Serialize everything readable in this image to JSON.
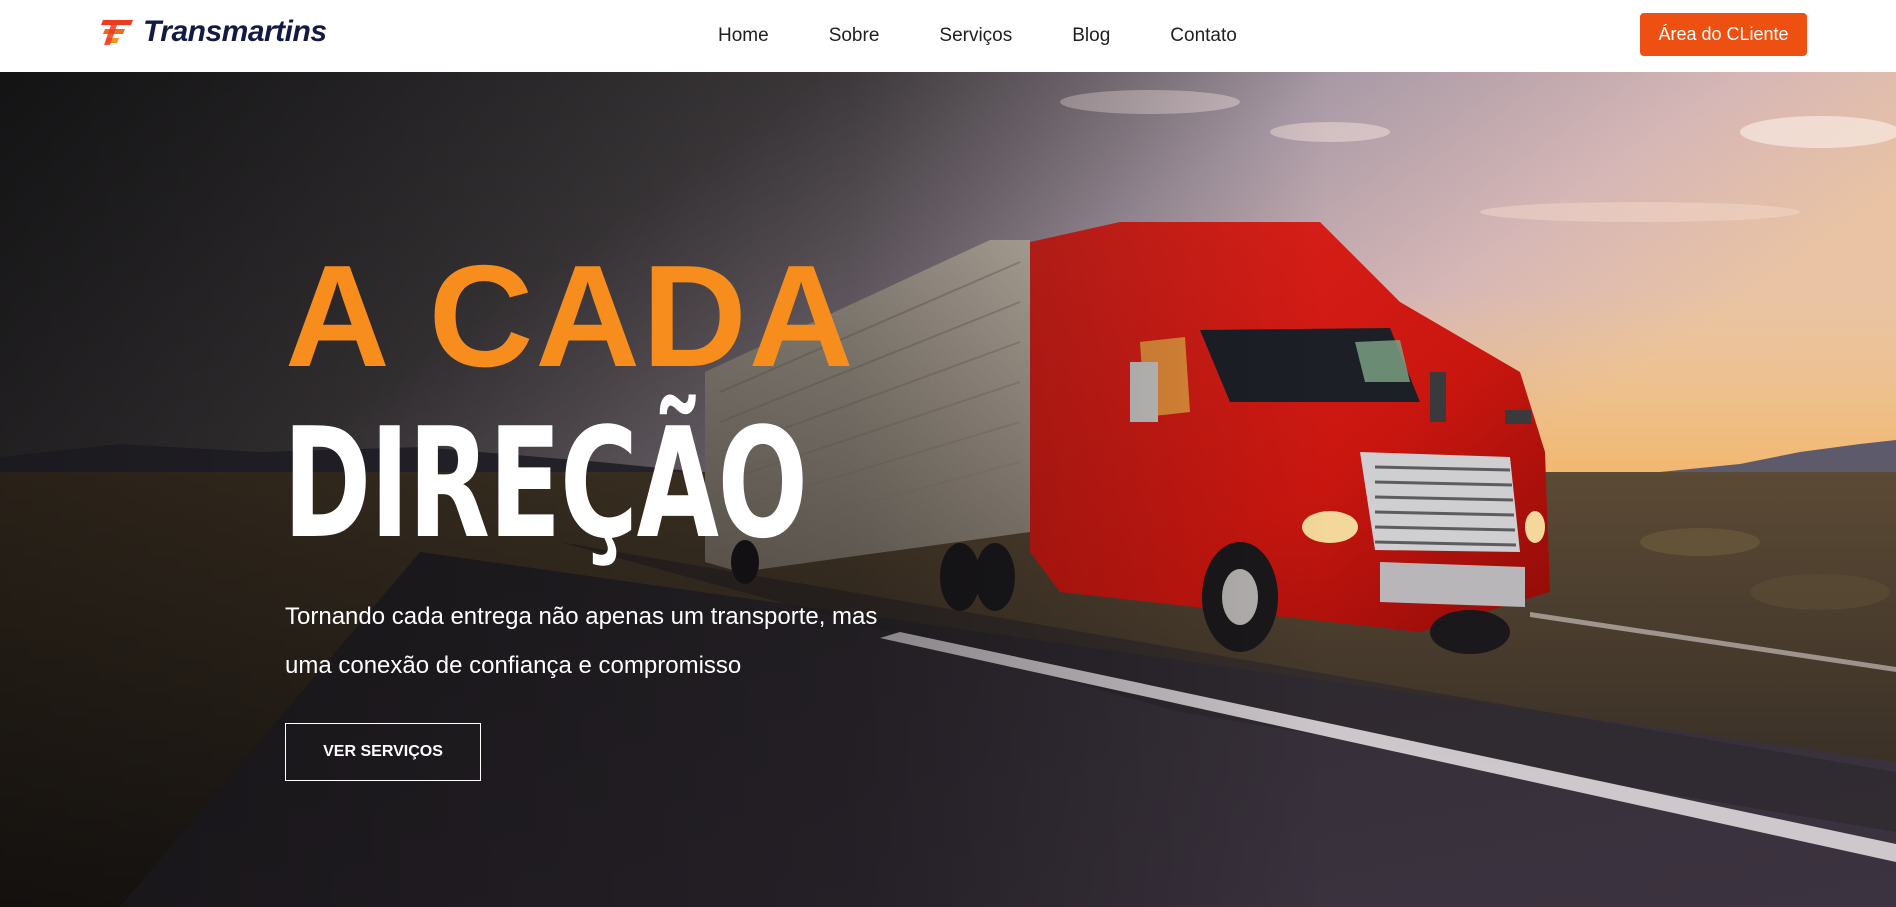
{
  "header": {
    "brand": "Transmartins",
    "logo_icon": "speed-stripes-logo",
    "nav": [
      {
        "label": "Home"
      },
      {
        "label": "Sobre"
      },
      {
        "label": "Serviços"
      },
      {
        "label": "Blog"
      },
      {
        "label": "Contato"
      }
    ],
    "client_button": "Área do CLiente"
  },
  "hero": {
    "background_image": "red semi-truck on highway at sunset",
    "headline_line1": "A CADA",
    "headline_line2": "DIREÇÃO",
    "subtext_line1": "Tornando cada entrega não apenas um transporte, mas",
    "subtext_line2": "uma conexão de confiança e compromisso",
    "cta_label": "VER SERVIÇOS"
  },
  "colors": {
    "accent_orange": "#f78d1c",
    "button_orange": "#ed5011",
    "brand_navy": "#131a43"
  }
}
